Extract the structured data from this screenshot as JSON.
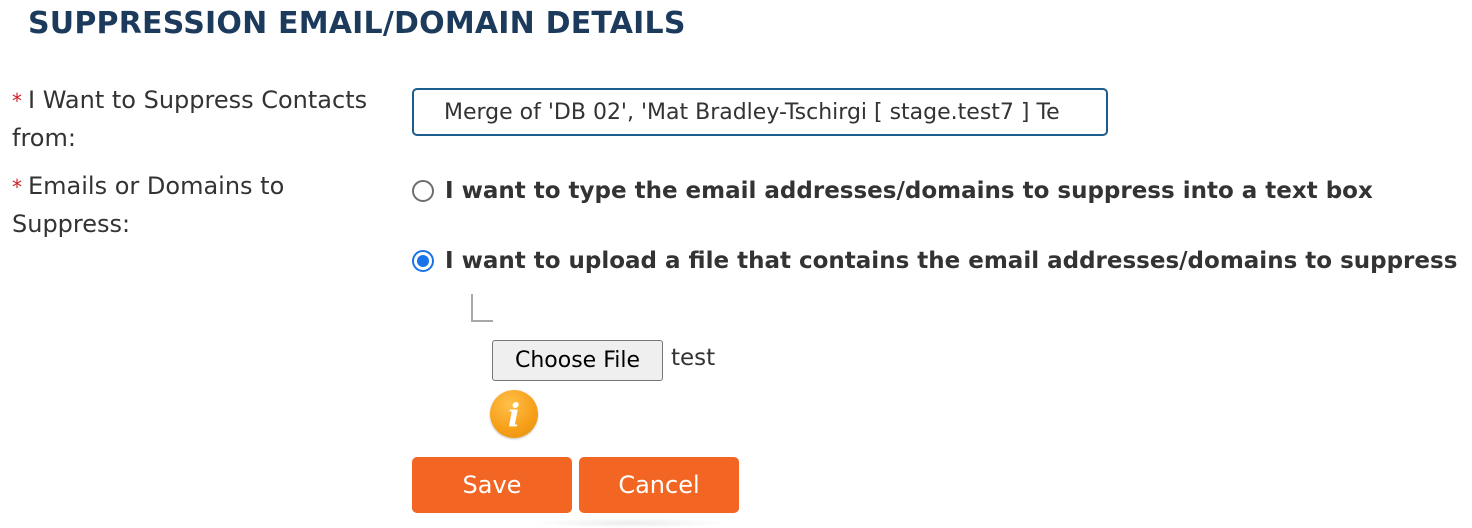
{
  "page": {
    "title": "SUPPRESSION EMAIL/DOMAIN DETAILS"
  },
  "form": {
    "required_marker": "*",
    "suppress_from": {
      "label": "I Want to Suppress Contacts from:",
      "value": "Merge of 'DB 02', 'Mat Bradley-Tschirgi [ stage.test7 ] Te"
    },
    "emails_or_domains": {
      "label": "Emails or Domains to Suppress:",
      "options": [
        {
          "label": "I want to type the email addresses/domains to suppress into a text box",
          "checked": false
        },
        {
          "label": "I want to upload a file that contains the email addresses/domains to suppress",
          "checked": true
        }
      ]
    },
    "file_upload": {
      "button_label": "Choose File",
      "file_name": "test",
      "info_icon": "info-icon"
    }
  },
  "actions": {
    "save_label": "Save",
    "cancel_label": "Cancel"
  },
  "colors": {
    "title": "#1b3a5c",
    "required": "#d0202a",
    "input_border": "#1c5d8f",
    "radio_selected": "#1a73e8",
    "button_bg": "#f26522",
    "info_icon": "#f7a11b"
  }
}
